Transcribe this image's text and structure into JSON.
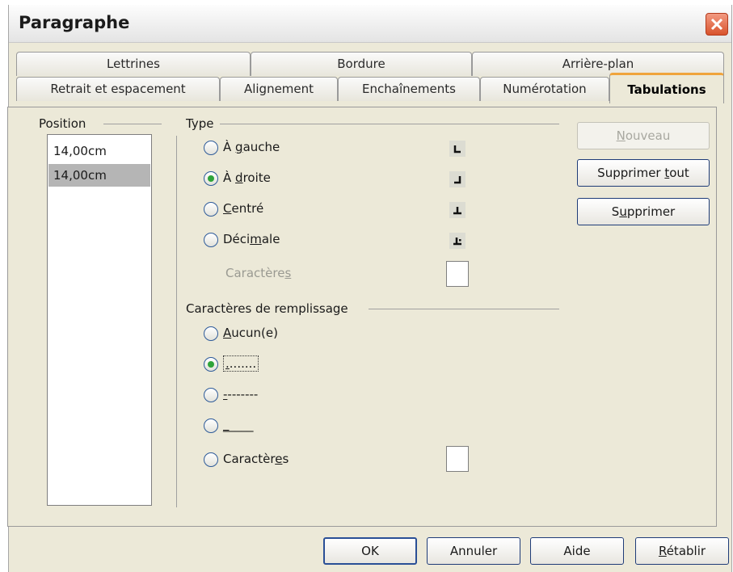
{
  "window": {
    "title": "Paragraphe"
  },
  "tabs_row1": [
    "Lettrines",
    "Bordure",
    "Arrière-plan"
  ],
  "tabs_row2": [
    "Retrait et espacement",
    "Alignement",
    "Enchaînements",
    "Numérotation",
    "Tabulations"
  ],
  "active_tab": "Tabulations",
  "position": {
    "label": "Position",
    "items": [
      "14,00cm",
      "14,00cm"
    ],
    "selected_index": 1
  },
  "type": {
    "label": "Type",
    "options": [
      {
        "pre": "À ",
        "acc": "g",
        "post": "auche",
        "checked": false,
        "icon": "tab-left-icon"
      },
      {
        "pre": "À ",
        "acc": "d",
        "post": "roite",
        "checked": true,
        "icon": "tab-right-icon"
      },
      {
        "pre": "",
        "acc": "C",
        "post": "entré",
        "checked": false,
        "icon": "tab-center-icon"
      },
      {
        "pre": "Déci",
        "acc": "m",
        "post": "ale",
        "checked": false,
        "icon": "tab-decimal-icon"
      }
    ],
    "characters_label": {
      "pre": "Caractère",
      "acc": "s",
      "post": ""
    }
  },
  "fill": {
    "label": "Caractères de remplissage",
    "options": [
      {
        "pre": "",
        "acc": "A",
        "post": "ucun(e)",
        "checked": false
      },
      {
        "pre": "",
        "acc": ".",
        "post": ".......",
        "checked": true
      },
      {
        "pre": "",
        "acc": "-",
        "post": "-------",
        "checked": false
      },
      {
        "pre": "",
        "acc": "_",
        "post": "____",
        "checked": false
      },
      {
        "pre": "Caractèr",
        "acc": "e",
        "post": "s",
        "checked": false
      }
    ]
  },
  "side_buttons": {
    "new": {
      "pre": "",
      "acc": "N",
      "post": "ouveau",
      "disabled": true
    },
    "delete_all": {
      "pre": "Supprimer ",
      "acc": "t",
      "post": "out"
    },
    "delete": {
      "pre": "S",
      "acc": "u",
      "post": "pprimer"
    }
  },
  "footer": {
    "ok": "OK",
    "cancel": "Annuler",
    "help": "Aide",
    "reset": {
      "pre": "",
      "acc": "R",
      "post": "établir"
    }
  },
  "colors": {
    "radio_dot": "#2ea43a",
    "active_tab_accent": "#f0a43c",
    "close_button": "#d9532c"
  }
}
